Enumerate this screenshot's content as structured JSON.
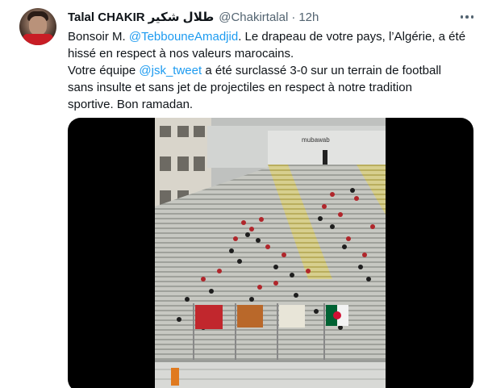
{
  "tweet": {
    "author": {
      "display_name": "Talal CHAKIR",
      "display_name_ar": "طلال شكير",
      "handle": "@Chakirtalal",
      "time": "12h"
    },
    "text": {
      "line1_pre": "Bonsoir M. ",
      "line1_mention": "@TebbouneAmadjid",
      "line1_post": ". Le drapeau de votre pays, l’Algérie, a été",
      "line2": "hissé en respect à nos valeurs marocains.",
      "line3_pre": "Votre équipe ",
      "line3_mention": "@jsk_tweet",
      "line3_post": " a été surclassé 3-0 sur un terrain de football",
      "line4": "sans insulte et sans jet de projectiles en respect à notre tradition",
      "line5": "sportive. Bon ramadan."
    },
    "media": {
      "type": "video",
      "banner_text": "mubawab"
    },
    "more_icon": "more-horizontal-icon"
  },
  "colors": {
    "link": "#1d9bf0",
    "secondary_text": "#536471",
    "primary_text": "#0f1419",
    "morocco_flag": "#c1272d",
    "algeria_green": "#006233"
  }
}
